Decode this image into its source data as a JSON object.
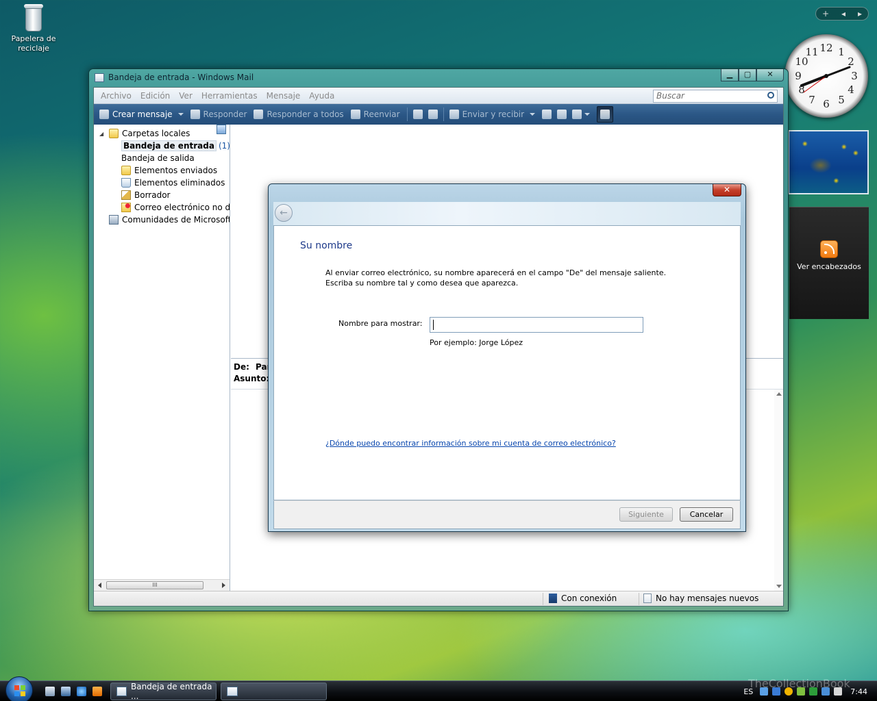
{
  "desktop": {
    "recycle_bin_label_line1": "Papelera de",
    "recycle_bin_label_line2": "reciclaje"
  },
  "gadgets": {
    "sidebar_controls": [
      "+",
      "◂",
      "▸"
    ],
    "clock_numbers": [
      "12",
      "1",
      "2",
      "3",
      "4",
      "5",
      "6",
      "7",
      "8",
      "9",
      "10",
      "11"
    ],
    "feeds_label": "Ver encabezados"
  },
  "window": {
    "title": "Bandeja de entrada - Windows Mail",
    "controls": {
      "minimize": "▁",
      "maximize": "▢",
      "close": "✕"
    },
    "menu": [
      "Archivo",
      "Edición",
      "Ver",
      "Herramientas",
      "Mensaje",
      "Ayuda"
    ],
    "search_placeholder": "Buscar",
    "toolbar": {
      "new_message": "Crear mensaje",
      "reply": "Responder",
      "reply_all": "Responder a todos",
      "forward": "Reenviar",
      "send_receive": "Enviar y recibir"
    },
    "folders": {
      "root": "Carpetas locales",
      "items": [
        {
          "label": "Bandeja de entrada",
          "count": "(1)"
        },
        {
          "label": "Bandeja de salida"
        },
        {
          "label": "Elementos enviados"
        },
        {
          "label": "Elementos eliminados"
        },
        {
          "label": "Borrador"
        },
        {
          "label": "Correo electrónico no des"
        }
      ],
      "communities": "Comunidades de Microsoft",
      "scroll_grip": "III"
    },
    "preview": {
      "from_label": "De:",
      "from_value": "Par",
      "subject_label": "Asunto:"
    },
    "status": {
      "connection": "Con conexión",
      "messages": "No hay mensajes nuevos"
    }
  },
  "dialog": {
    "close": "✕",
    "back": "←",
    "title": "Su nombre",
    "description_line1": "Al enviar correo electrónico, su nombre aparecerá en el campo \"De\" del mensaje saliente.",
    "description_line2": "Escriba su nombre tal y como desea que aparezca.",
    "field_label": "Nombre para mostrar:",
    "field_value": "",
    "example": "Por ejemplo: Jorge López",
    "help_link": "¿Dónde puedo encontrar información sobre mi cuenta de correo electrónico?",
    "next_button": "Siguiente",
    "cancel_button": "Cancelar"
  },
  "taskbar": {
    "tasks": [
      "Bandeja de entrada ...",
      ""
    ],
    "language": "ES",
    "time": "7:44"
  },
  "watermark": "TheCollectionBook"
}
